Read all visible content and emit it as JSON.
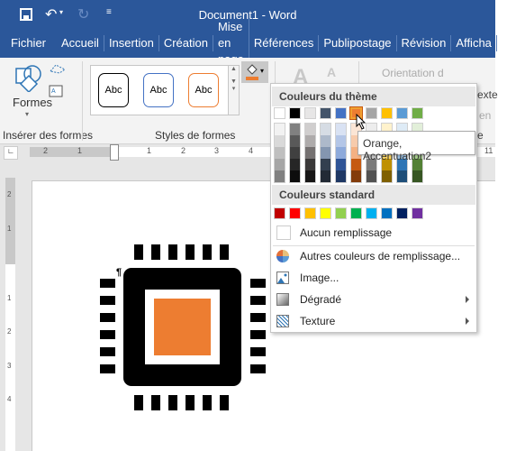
{
  "title": "Document1  -  Word",
  "tabs": [
    "Fichier",
    "Accueil",
    "Insertion",
    "Création",
    "Mise en page",
    "Références",
    "Publipostage",
    "Révision",
    "Afficha"
  ],
  "ribbon": {
    "shapes_label": "Formes",
    "group_insert": "Insérer des formes",
    "group_styles": "Styles de formes",
    "style_samples": [
      "Abc",
      "Abc",
      "Abc"
    ],
    "style_colors": [
      "#000000",
      "#4472c4",
      "#ed7d31"
    ],
    "text_a": "A",
    "orientation": "Orientation d",
    "partial_texte": "exte",
    "partial_en": "en",
    "partial_e": "e"
  },
  "ruler": {
    "h_ticks": [
      "2",
      "1",
      "1",
      "2",
      "3",
      "4",
      "11"
    ],
    "v_ticks": [
      "2",
      "1",
      "1",
      "2",
      "3",
      "4"
    ]
  },
  "fill_color": "#ed7d31",
  "menu": {
    "theme_header": "Couleurs du thème",
    "theme_colors": [
      "#ffffff",
      "#000000",
      "#e7e6e6",
      "#44546a",
      "#4472c4",
      "#ed7d31",
      "#a5a5a5",
      "#ffc000",
      "#5b9bd5",
      "#70ad47"
    ],
    "theme_shades": [
      [
        "#f2f2f2",
        "#d9d9d9",
        "#bfbfbf",
        "#a6a6a6",
        "#808080"
      ],
      [
        "#808080",
        "#595959",
        "#404040",
        "#262626",
        "#0d0d0d"
      ],
      [
        "#d0cece",
        "#aeabab",
        "#757171",
        "#3a3838",
        "#171616"
      ],
      [
        "#d6dce4",
        "#adb9ca",
        "#8496b0",
        "#333f4f",
        "#222a35"
      ],
      [
        "#d9e2f3",
        "#b4c6e7",
        "#8eaadb",
        "#2f5496",
        "#1f3864"
      ],
      [
        "#fbe5d5",
        "#f7cbac",
        "#f4b183",
        "#c55a11",
        "#833c0b"
      ],
      [
        "#ededed",
        "#dbdbdb",
        "#c9c9c9",
        "#7b7b7b",
        "#525252"
      ],
      [
        "#fff2cc",
        "#fee599",
        "#ffd965",
        "#bf9000",
        "#7f6000"
      ],
      [
        "#deebf6",
        "#bdd7ee",
        "#9dc3e6",
        "#2e75b5",
        "#1e4e79"
      ],
      [
        "#e2efd9",
        "#c5e0b3",
        "#a8d08d",
        "#538135",
        "#375623"
      ]
    ],
    "selected_index": 5,
    "standard_header": "Couleurs standard",
    "standard_colors": [
      "#c00000",
      "#ff0000",
      "#ffc000",
      "#ffff00",
      "#92d050",
      "#00b050",
      "#00b0f0",
      "#0070c0",
      "#002060",
      "#7030a0"
    ],
    "no_fill": "Aucun remplissage",
    "more_colors": "Autres couleurs de remplissage...",
    "image": "Image...",
    "gradient": "Dégradé",
    "texture": "Texture"
  },
  "tooltip": "Orange, Accentuation2",
  "doc": {
    "pilcrow": "¶"
  }
}
